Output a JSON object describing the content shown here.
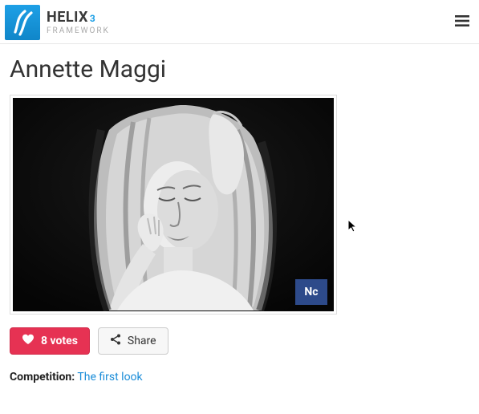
{
  "header": {
    "brand_main": "HELIX",
    "brand_sub": "3",
    "brand_tag": "FRAMEWORK"
  },
  "page": {
    "title": "Annette Maggi"
  },
  "photo": {
    "badge": "Nc"
  },
  "actions": {
    "votes_label": "8 votes",
    "share_label": "Share"
  },
  "meta": {
    "competition_label": "Competition:",
    "competition_link": "The first look"
  }
}
